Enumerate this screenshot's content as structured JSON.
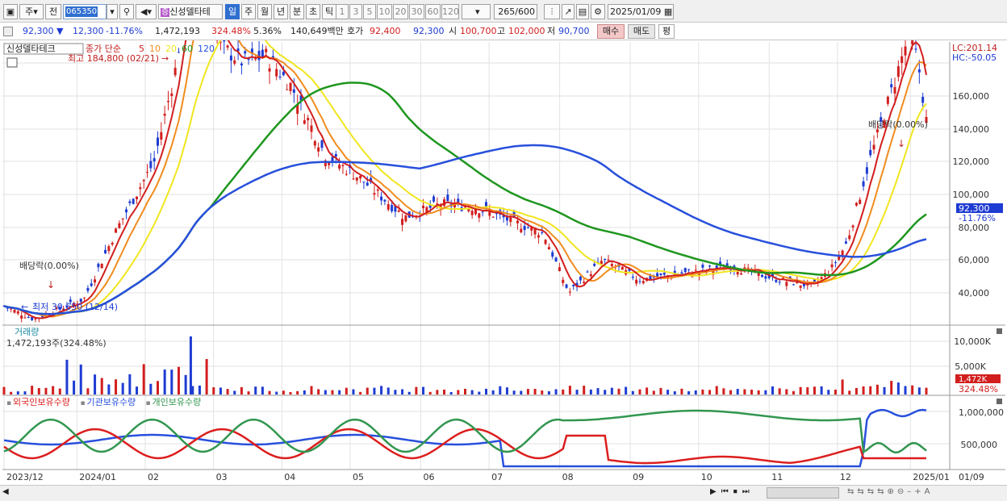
{
  "toolbar": {
    "menu1": "주",
    "menu2": "전",
    "code": "065350",
    "name": "신성델타테",
    "periods": [
      "일",
      "주",
      "월",
      "년",
      "분",
      "초",
      "틱"
    ],
    "active_period": "일",
    "minutes": [
      "1",
      "3",
      "5",
      "10",
      "20",
      "30",
      "60",
      "120"
    ],
    "count": "265",
    "count_max": "/600",
    "date": "2025/01/09"
  },
  "quote": {
    "price": "92,300",
    "change": "12,300",
    "change_pct": "-11.76%",
    "volume": "1,472,193",
    "vol_ratio": "324.48%",
    "turnover": "5.36%",
    "amount": "140,649백만",
    "bid_label": "호가",
    "bid": "92,400",
    "ask": "92,300",
    "open_label": "시",
    "open": "100,700",
    "high_label": "고",
    "high": "102,000",
    "low_label": "저",
    "low": "90,700",
    "buy": "매수",
    "sell": "매도",
    "avg": "평"
  },
  "legend": {
    "name": "신성델타테크",
    "price_label": "종가 단순",
    "ma": [
      "5",
      "10",
      "20",
      "60",
      "120"
    ]
  },
  "annotations": {
    "high": "최고 184,800 (02/21)",
    "low": "최저 30,650 (12/14)",
    "div1": "배당락(0.00%)",
    "div2": "배당락(0.00%)",
    "lc": "LC:201.14",
    "hc": "HC:-50.05",
    "last_price": "92,300",
    "last_pct": "-11.76%"
  },
  "y_axis_price": [
    "160,000",
    "140,000",
    "120,000",
    "100,000",
    "80,000",
    "60,000",
    "40,000"
  ],
  "volume_panel": {
    "title": "거래량",
    "info": "1,472,193주(324.48%)",
    "axis": [
      "10,000K",
      "5,000K"
    ],
    "last": "1,472K",
    "last_pct": "324.48%"
  },
  "holdings_panel": {
    "series": [
      "외국인보유수량",
      "기관보유수량",
      "개인보유수량"
    ],
    "axis": [
      "1,000,000",
      "500,000"
    ]
  },
  "x_axis": [
    "2023/12",
    "2024/01",
    "02",
    "03",
    "04",
    "05",
    "06",
    "07",
    "08",
    "09",
    "10",
    "11",
    "12",
    "2025/01",
    "01/09"
  ],
  "colors": {
    "up": "#d21e1e",
    "down": "#1e3cd2",
    "ma5": "#d21e1e",
    "ma10": "#f08c1e",
    "ma20": "#f0e61e",
    "ma60": "#1e961e",
    "ma120": "#2850dc",
    "foreign": "#dc1e1e",
    "inst": "#2850dc",
    "retail": "#329650"
  },
  "chart_data": {
    "type": "candlestick",
    "ylim": [
      30000,
      190000
    ],
    "close_points": [
      [
        "2023-12-01",
        36000
      ],
      [
        "2023-12-14",
        32000
      ],
      [
        "2024-01-05",
        38000
      ],
      [
        "2024-01-20",
        60000
      ],
      [
        "2024-02-05",
        80000
      ],
      [
        "2024-02-15",
        110000
      ],
      [
        "2024-02-21",
        150000
      ],
      [
        "2024-02-26",
        132000
      ],
      [
        "2024-03-05",
        115000
      ],
      [
        "2024-03-15",
        110000
      ],
      [
        "2024-03-25",
        112000
      ],
      [
        "2024-04-05",
        103000
      ],
      [
        "2024-04-20",
        82000
      ],
      [
        "2024-05-05",
        75000
      ],
      [
        "2024-05-25",
        63000
      ],
      [
        "2024-06-10",
        67000
      ],
      [
        "2024-06-25",
        66000
      ],
      [
        "2024-07-10",
        62000
      ],
      [
        "2024-07-25",
        58000
      ],
      [
        "2024-08-05",
        40000
      ],
      [
        "2024-08-20",
        50000
      ],
      [
        "2024-09-05",
        44000
      ],
      [
        "2024-09-25",
        46000
      ],
      [
        "2024-10-15",
        48000
      ],
      [
        "2024-11-05",
        44000
      ],
      [
        "2024-11-20",
        42000
      ],
      [
        "2024-11-28",
        47000
      ],
      [
        "2024-12-05",
        55000
      ],
      [
        "2024-12-15",
        80000
      ],
      [
        "2024-12-26",
        104000
      ],
      [
        "2025-01-02",
        120000
      ],
      [
        "2025-01-06",
        107000
      ],
      [
        "2025-01-09",
        92300
      ]
    ]
  }
}
